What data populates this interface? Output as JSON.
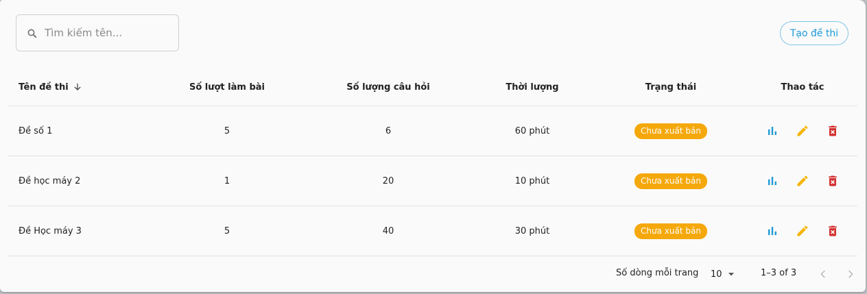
{
  "search": {
    "placeholder": "Tìm kiếm tên..."
  },
  "toolbar": {
    "create_label": "Tạo đề thi"
  },
  "table": {
    "columns": {
      "name": "Tên đề thi",
      "attempts": "Số lượt làm bài",
      "questions": "Số lượng câu hỏi",
      "duration": "Thời lượng",
      "status": "Trạng thái",
      "actions": "Thao tác"
    },
    "rows": [
      {
        "name": "Đề số 1",
        "attempts": "5",
        "questions": "6",
        "duration": "60 phút",
        "status": "Chưa xuất bản"
      },
      {
        "name": "Đề học máy 2",
        "attempts": "1",
        "questions": "20",
        "duration": "10 phút",
        "status": "Chưa xuất bản"
      },
      {
        "name": "Đề Học máy 3",
        "attempts": "5",
        "questions": "40",
        "duration": "30 phút",
        "status": "Chưa xuất bản"
      }
    ],
    "sort": {
      "column": "name",
      "icon": "arrow-down-icon"
    }
  },
  "pagination": {
    "rows_per_page_label": "Số dòng mỗi trang",
    "rows_per_page_value": "10",
    "range_label": "1–3 of 3"
  },
  "colors": {
    "accent": "#1e9ad6",
    "badge": "#f5a80b",
    "edit": "#f5b400",
    "delete": "#d32f2f",
    "stats": "#1e9ad6"
  },
  "icons": {
    "search": "search-icon",
    "stats": "bar-chart-icon",
    "edit": "pencil-icon",
    "delete": "trash-icon",
    "prev": "chevron-left-icon",
    "next": "chevron-right-icon",
    "dropdown": "caret-down-icon"
  }
}
